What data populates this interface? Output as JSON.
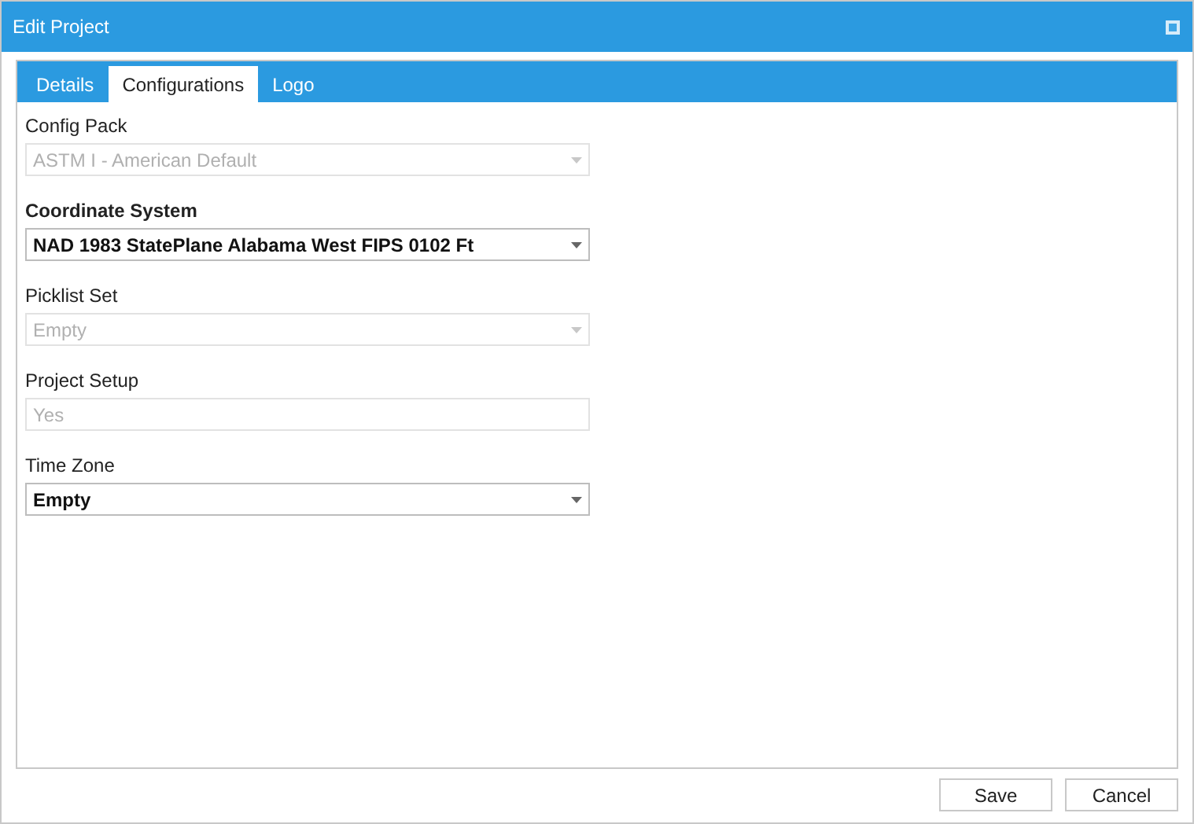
{
  "window": {
    "title": "Edit Project"
  },
  "tabs": [
    {
      "label": "Details",
      "selected": false
    },
    {
      "label": "Configurations",
      "selected": true
    },
    {
      "label": "Logo",
      "selected": false
    }
  ],
  "fields": [
    {
      "label": "Config Pack",
      "label_bold": false,
      "kind": "dropdown",
      "value": "ASTM I - American Default",
      "disabled": true
    },
    {
      "label": "Coordinate System",
      "label_bold": true,
      "kind": "dropdown",
      "value": "NAD 1983 StatePlane Alabama West FIPS 0102 Ft",
      "disabled": false
    },
    {
      "label": "Picklist Set",
      "label_bold": false,
      "kind": "dropdown",
      "value": "Empty",
      "disabled": true
    },
    {
      "label": "Project Setup",
      "label_bold": false,
      "kind": "text",
      "value": "Yes",
      "disabled": true
    },
    {
      "label": "Time Zone",
      "label_bold": false,
      "kind": "dropdown",
      "value": "Empty",
      "disabled": false
    }
  ],
  "buttons": [
    "Save",
    "Cancel"
  ]
}
